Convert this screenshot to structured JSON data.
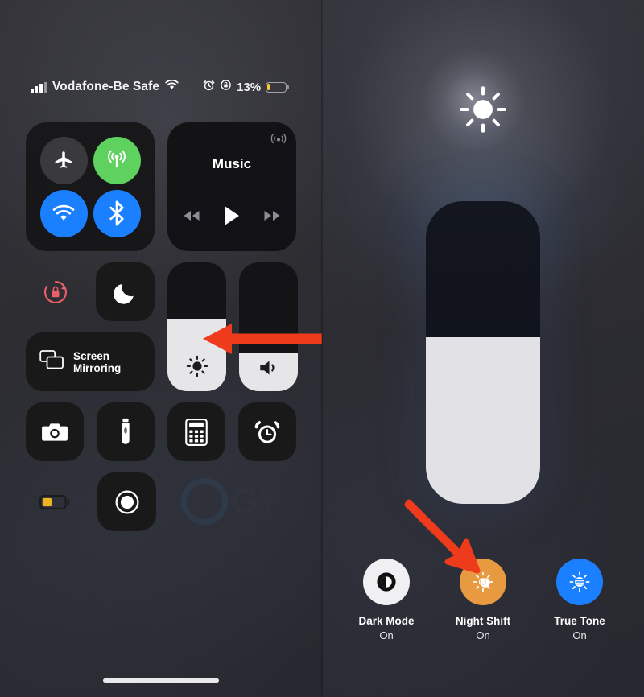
{
  "screen": {
    "title": "iOS Control Center with brightness slider and display options",
    "accent_red": "#ee3b1c",
    "background": "#2d2d31"
  },
  "status_bar": {
    "carrier": "Vodafone-Be Safe",
    "battery_percent": "13%",
    "battery_level": 13,
    "icons": [
      "cellular-signal-icon",
      "wifi-icon",
      "alarm-icon",
      "rotation-lock-icon",
      "battery-icon"
    ]
  },
  "control_center": {
    "connectivity": {
      "buttons": [
        {
          "name": "airplane-mode",
          "icon": "airplane-icon",
          "state": "off",
          "color": "#3a3a3c"
        },
        {
          "name": "cellular-data",
          "icon": "cellular-icon",
          "state": "on",
          "color": "#5ed15e"
        },
        {
          "name": "wifi",
          "icon": "wifi-icon",
          "state": "on",
          "color": "#1a80ff"
        },
        {
          "name": "bluetooth",
          "icon": "bluetooth-icon",
          "state": "on",
          "color": "#1a80ff"
        }
      ]
    },
    "music": {
      "title": "Music",
      "airplay_icon": "airplay-icon",
      "controls": [
        "rewind-icon",
        "play-icon",
        "fast-forward-icon"
      ]
    },
    "toggles": {
      "rotation_lock": {
        "icon": "rotation-lock-icon",
        "state": "on",
        "color": "#e4e4e6"
      },
      "do_not_disturb": {
        "icon": "moon-icon",
        "state": "off"
      },
      "screen_mirroring": {
        "label_line1": "Screen",
        "label_line2": "Mirroring",
        "icon": "screen-mirroring-icon"
      },
      "low_power_mode": {
        "icon": "battery-icon",
        "state": "on",
        "color": "#e4e4e6"
      },
      "screen_record": {
        "icon": "record-icon",
        "state": "off"
      }
    },
    "shortcuts": [
      {
        "name": "camera",
        "icon": "camera-icon"
      },
      {
        "name": "flashlight",
        "icon": "flashlight-icon"
      },
      {
        "name": "calculator",
        "icon": "calculator-icon"
      },
      {
        "name": "alarm",
        "icon": "alarm-clock-icon"
      }
    ],
    "sliders": {
      "brightness": {
        "icon": "brightness-icon",
        "value_percent": 56
      },
      "volume": {
        "icon": "volume-icon",
        "value_percent": 30
      }
    }
  },
  "brightness_panel": {
    "top_icon": "brightness-sun-icon",
    "slider": {
      "name": "brightness-slider-expanded",
      "value_percent": 55
    },
    "display_modes": [
      {
        "name": "Dark Mode",
        "state": "On",
        "icon": "dark-mode-icon",
        "color": "#f0f0f2"
      },
      {
        "name": "Night Shift",
        "state": "On",
        "icon": "night-shift-icon",
        "color": "#e89a40"
      },
      {
        "name": "True Tone",
        "state": "On",
        "icon": "true-tone-icon",
        "color": "#1a80ff"
      }
    ]
  },
  "annotations": [
    {
      "name": "arrow-to-brightness-slider",
      "direction": "left",
      "color": "#ee3b1c"
    },
    {
      "name": "arrow-to-night-shift",
      "direction": "down-right",
      "color": "#ee3b1c"
    }
  ],
  "watermark": {
    "text": "GY"
  }
}
